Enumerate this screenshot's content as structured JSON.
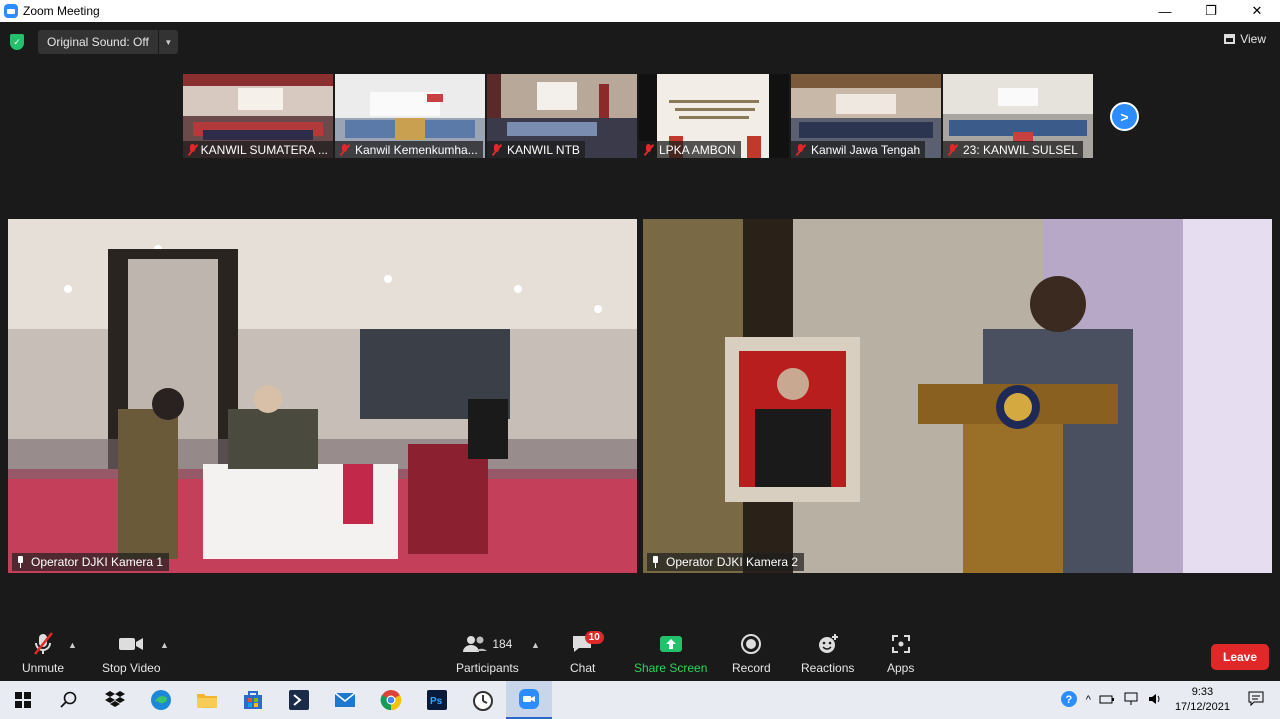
{
  "window": {
    "title": "Zoom Meeting",
    "controls": [
      "—",
      "❐",
      "✕"
    ]
  },
  "topbar": {
    "original_sound": "Original Sound: Off",
    "view_label": "View"
  },
  "thumbnails": [
    {
      "name": "KANWIL SUMATERA ...",
      "colors": [
        "#d8c9c0",
        "#b33a3a",
        "#2d2d4a"
      ]
    },
    {
      "name": "Kanwil Kemenkumha...",
      "colors": [
        "#e6e6e6",
        "#5b7aa8",
        "#3a3f55"
      ]
    },
    {
      "name": "KANWIL NTB",
      "colors": [
        "#b8a89a",
        "#3a3a4a",
        "#7a8cb0"
      ]
    },
    {
      "name": "LPKA AMBON",
      "colors": [
        "#f2ede6",
        "#8a7a5a",
        "#c0392b"
      ]
    },
    {
      "name": "Kanwil Jawa Tengah",
      "colors": [
        "#c8b8a8",
        "#2b3550",
        "#a8b8c8"
      ]
    },
    {
      "name": "23: KANWIL SULSEL",
      "colors": [
        "#e6e2dc",
        "#3b5b8a",
        "#c94040"
      ]
    }
  ],
  "videos": [
    {
      "name": "Operator DJKI Kamera 1"
    },
    {
      "name": "Operator DJKI  Kamera 2"
    }
  ],
  "toolbar": {
    "unmute": "Unmute",
    "stop_video": "Stop Video",
    "participants": "Participants",
    "participants_count": "184",
    "chat": "Chat",
    "chat_badge": "10",
    "share_screen": "Share Screen",
    "record": "Record",
    "reactions": "Reactions",
    "apps": "Apps",
    "leave": "Leave"
  },
  "taskbar": {
    "time": "9:33",
    "date": "17/12/2021"
  },
  "colors": {
    "accent": "#2d8cff",
    "danger": "#e02828",
    "share_green": "#23d959"
  }
}
